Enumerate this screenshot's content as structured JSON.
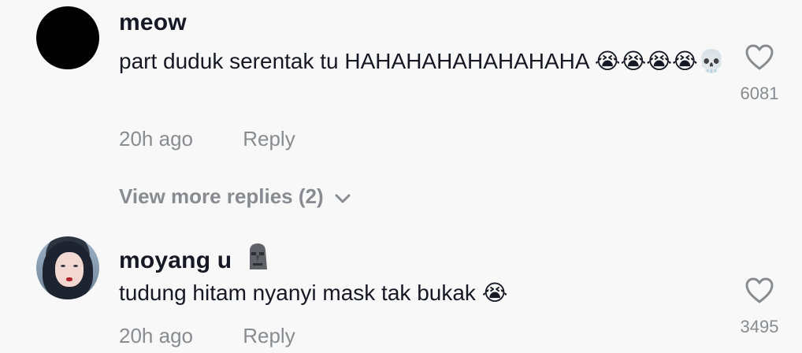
{
  "comments": [
    {
      "username": "meow",
      "text": "part duduk serentak tu HAHAHAHAHAHAHAHA 😭😭😭😭💀",
      "time": "20h ago",
      "reply_label": "Reply",
      "likes": "6081",
      "avatar": "black-avatar"
    },
    {
      "username": "moyang u",
      "username_emoji": "moai",
      "text": "tudung hitam nyanyi mask tak bukak 😭",
      "time": "20h ago",
      "reply_label": "Reply",
      "likes": "3495",
      "avatar": "photo-avatar"
    }
  ],
  "view_more": {
    "label": "View more replies (2)"
  },
  "colors": {
    "background": "#f8f8f8",
    "primary_text": "#161823",
    "secondary_text": "#8a8b91"
  }
}
